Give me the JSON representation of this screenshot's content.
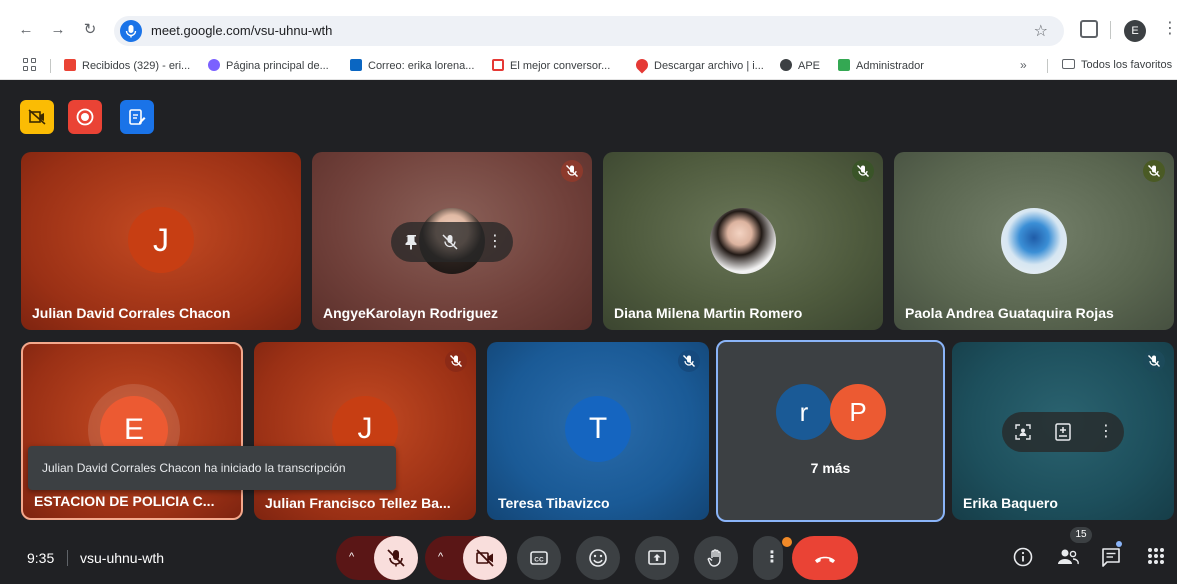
{
  "browser": {
    "url": "meet.google.com/vsu-uhnu-wth",
    "profile_initial": "E",
    "bookmarks": [
      {
        "label": "Recibidos (329) - eri...",
        "color": "#ea4335"
      },
      {
        "label": "Página principal de...",
        "color": "#7b61ff"
      },
      {
        "label": "Correo: erika lorena...",
        "color": "#0a66c2"
      },
      {
        "label": "El mejor conversor...",
        "color": "#e53935"
      },
      {
        "label": "Descargar archivo | i...",
        "color": "#e53935"
      },
      {
        "label": "APE",
        "color": "#202124"
      },
      {
        "label": "Administrador",
        "color": "#34a853"
      }
    ],
    "overflow_label": "»",
    "all_bookmarks_label": "Todos los favoritos"
  },
  "meeting": {
    "time": "9:35",
    "code": "vsu-uhnu-wth",
    "participant_count": "15",
    "toast": "Julian David Corrales Chacon ha iniciado la transcripción"
  },
  "tiles": {
    "t1": {
      "name": "Julian David Corrales Chacon",
      "initial": "J"
    },
    "t2": {
      "name": "AngyeKarolayn Rodriguez"
    },
    "t3": {
      "name": "Diana Milena Martin Romero"
    },
    "t4": {
      "name": "Paola Andrea Guataquira Rojas"
    },
    "t5": {
      "name": "ESTACION DE POLICIA C...",
      "initial": "E"
    },
    "t6": {
      "name": "Julian Francisco Tellez Ba...",
      "initial": "J"
    },
    "t7": {
      "name": "Teresa Tibavizco",
      "initial": "T"
    },
    "t8": {
      "more": "7 más",
      "initial_a": "r",
      "initial_b": "P"
    },
    "t9": {
      "name": "Erika Baquero"
    }
  },
  "colors": {
    "end_call": "#ea4335",
    "mic_off_bg": "#f9dedc",
    "caret_bg": "#5a1616",
    "ctl_bg": "#3c4043",
    "tile_orange": "#b8401f",
    "tile_blue": "#1a5a96",
    "tile_teal": "#1d4f5c",
    "tile_gray": "#3c4043",
    "accent_blue": "#8ab4f8"
  },
  "icons": [
    "back-arrow-icon",
    "forward-arrow-icon",
    "reload-icon",
    "microphone-icon",
    "star-icon",
    "extensions-icon",
    "kebab-icon",
    "apps-grid-icon",
    "folder-icon",
    "no-video-icon",
    "record-icon",
    "transcript-icon",
    "mic-off-icon",
    "pin-icon",
    "caption-icon",
    "emoji-icon",
    "present-icon",
    "hand-raise-icon",
    "end-call-icon",
    "info-icon",
    "people-icon",
    "chat-icon",
    "activities-icon"
  ]
}
